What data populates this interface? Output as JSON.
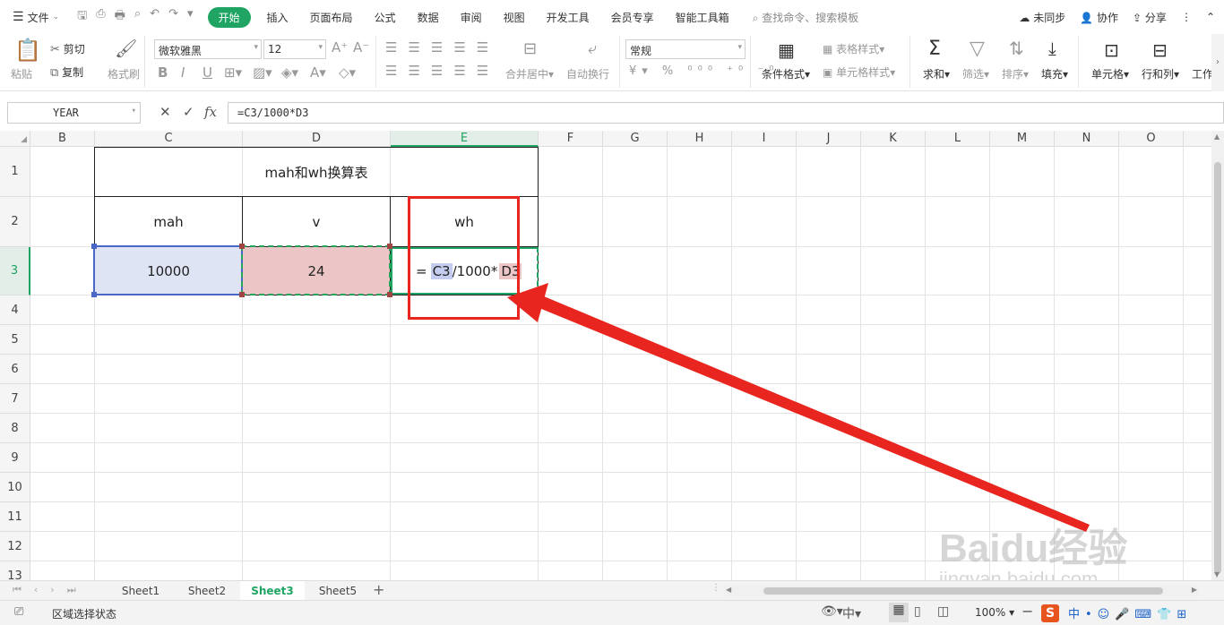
{
  "menubar": {
    "file_label": "文件",
    "tabs": [
      "开始",
      "插入",
      "页面布局",
      "公式",
      "数据",
      "审阅",
      "视图",
      "开发工具",
      "会员专享",
      "智能工具箱"
    ],
    "search_placeholder": "查找命令、搜索模板",
    "sync_label": "未同步",
    "collab_label": "协作",
    "share_label": "分享"
  },
  "ribbon": {
    "paste": "粘贴",
    "cut": "剪切",
    "copy": "复制",
    "format_painter": "格式刷",
    "font_name": "微软雅黑",
    "font_size": "12",
    "merge_center": "合并居中",
    "wrap_text": "自动换行",
    "number_format": "常规",
    "conditional_format": "条件格式",
    "table_style": "表格样式",
    "cell_style": "单元格样式",
    "sum": "求和",
    "filter": "筛选",
    "sort": "排序",
    "fill": "填充",
    "cell": "单元格",
    "row_col": "行和列",
    "worksheet": "工作"
  },
  "formula_bar": {
    "name_box": "YEAR",
    "formula": "=C3/1000*D3"
  },
  "grid": {
    "columns": [
      "B",
      "C",
      "D",
      "E",
      "F",
      "G",
      "H",
      "I",
      "J",
      "K",
      "L",
      "M",
      "N",
      "O"
    ],
    "rows": [
      "1",
      "2",
      "3",
      "4",
      "5",
      "6",
      "7",
      "8",
      "9",
      "10",
      "11",
      "12",
      "13"
    ],
    "title": "mah和wh换算表",
    "headers": [
      "mah",
      "v",
      "wh"
    ],
    "values": {
      "c3": "10000",
      "d3": "24"
    },
    "edit_formula": {
      "eq": "=",
      "ref1": "C3",
      "mid": "/1000*",
      "ref2": "D3"
    }
  },
  "sheets": [
    "Sheet1",
    "Sheet2",
    "Sheet3",
    "Sheet5"
  ],
  "active_sheet": "Sheet3",
  "status": {
    "mode": "区域选择状态",
    "zoom": "100%"
  },
  "watermark": {
    "brand": "Baidu经验",
    "url": "jingyan.baidu.com"
  },
  "colors": {
    "accent": "#1fa463",
    "annotation": "#e8261f",
    "ref_blue": "#dfe4f5",
    "ref_pink": "#ecc6c6"
  }
}
